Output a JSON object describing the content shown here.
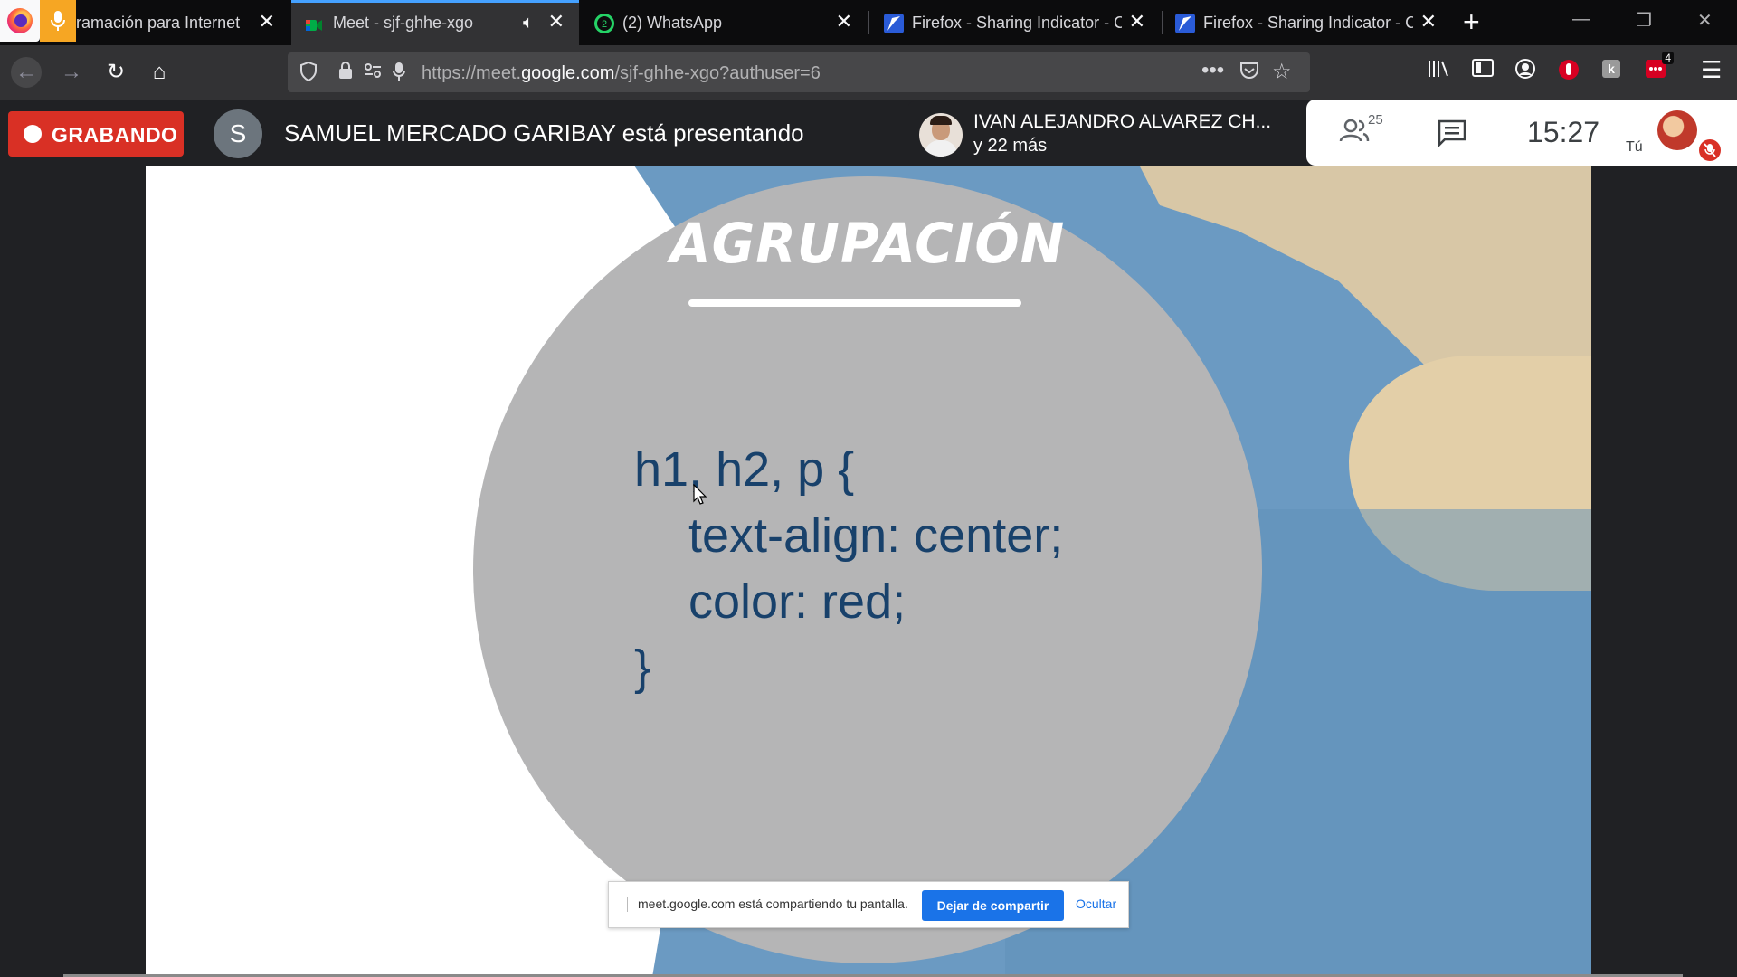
{
  "browser": {
    "tabs": [
      {
        "title": "ramación para Internet",
        "close": "✕"
      },
      {
        "title": "Meet - sjf-ghhe-xgo",
        "close": "✕",
        "active": true
      },
      {
        "title": "(2) WhatsApp",
        "close": "✕",
        "badge": "2"
      },
      {
        "title": "Firefox - Sharing Indicator - C",
        "close": "✕"
      },
      {
        "title": "Firefox - Sharing Indicator - C",
        "close": "✕"
      }
    ],
    "new_tab": "+",
    "window": {
      "minimize": "—",
      "restore": "❐",
      "close": "✕"
    },
    "url": {
      "prefix": "https://meet.",
      "domain": "google.com",
      "path": "/sjf-ghhe-xgo?authuser=6"
    },
    "extension_badge": "4",
    "accent": "#45a1ff"
  },
  "meet": {
    "recording_label": "GRABANDO",
    "presenter_initial": "S",
    "presenter_text": "SAMUEL MERCADO GARIBAY está presentando",
    "speaker_name": "IVAN ALEJANDRO ALVAREZ CH...",
    "speaker_more": "y 22 más",
    "participants_count": "25",
    "time": "15:27",
    "you_label": "Tú",
    "record_color": "#d93025"
  },
  "slide": {
    "title": "AGRUPACIÓN",
    "code_lines": [
      "h1, h2, p {",
      "    text-align: center;",
      "    color: red;",
      "}"
    ]
  },
  "share_indicator": {
    "text": "meet.google.com está compartiendo tu pantalla.",
    "stop_label": "Dejar de compartir",
    "hide_label": "Ocultar"
  }
}
